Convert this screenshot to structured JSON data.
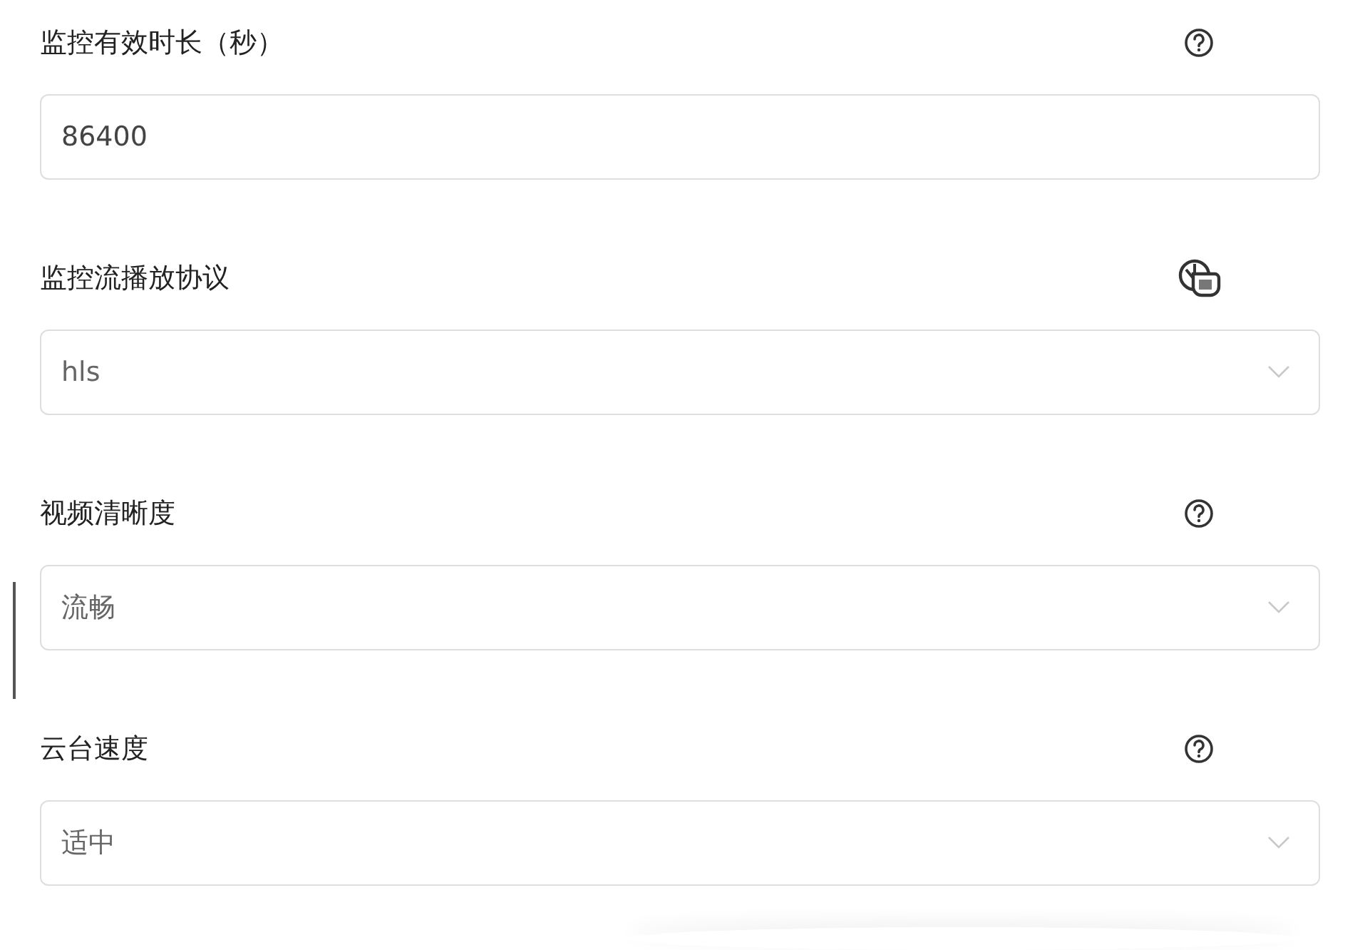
{
  "fields": [
    {
      "label": "监控有效时长（秒）",
      "kind": "input",
      "value": "86400",
      "hovered": false
    },
    {
      "label": "监控流播放协议",
      "kind": "select",
      "value": "hls",
      "hovered": true
    },
    {
      "label": "视频清晰度",
      "kind": "select",
      "value": "流畅",
      "hovered": false
    },
    {
      "label": "云台速度",
      "kind": "select",
      "value": "适中",
      "hovered": false
    }
  ]
}
